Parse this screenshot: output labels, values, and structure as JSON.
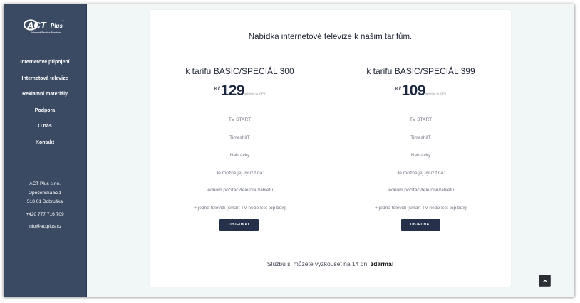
{
  "sidebar": {
    "logo_text": "ACT Plus s.r.o.",
    "logo_tagline": "Internet Service Provider",
    "nav": [
      {
        "label": "Internetové připojení"
      },
      {
        "label": "Internetová televize"
      },
      {
        "label": "Reklamní materiály"
      },
      {
        "label": "Podpora"
      },
      {
        "label": "O nás"
      },
      {
        "label": "Kontakt"
      }
    ],
    "contact": {
      "company": "ACT Plus s.r.o.",
      "street": "Opočenská 531",
      "city": "518 01 Dobruška",
      "phone": "+420 777 716 709",
      "email": "info@actplus.cz"
    }
  },
  "main": {
    "title": "Nabídka internetové televize k našim tarifům.",
    "tariffs": [
      {
        "name": "k tarifu BASIC/SPECIÁL 300",
        "currency": "Kč",
        "price": "129",
        "price_note": "měsíčně vč. DPH",
        "features": [
          "TV START",
          "TimeshifT",
          "Nahrávky",
          "Je možné jej využít na:",
          "jednom počítači/telefonu/tabletu",
          "+ jedné televizi (smart TV nebo Set-top box)"
        ],
        "button": "OBJEDNAT"
      },
      {
        "name": "k tarifu BASIC/SPECIÁL 399",
        "currency": "Kč",
        "price": "109",
        "price_note": "měsíčně vč. DPH",
        "features": [
          "TV START",
          "TimeshifT",
          "Nahrávky",
          "Je možné jej využít na:",
          "jednom počítači/telefonu/tabletu",
          "+ jedné televizi (smart TV nebo Set-top box)"
        ],
        "button": "OBJEDNAT"
      }
    ],
    "trial": {
      "before": "Službu si můžete vyzkoušet na 14 dní ",
      "bold": "zdarma",
      "after": "!"
    }
  },
  "scroll_top": {
    "icon": "chevron-up-icon"
  },
  "colors": {
    "sidebar_bg": "#3a4a63",
    "button_bg": "#25304a",
    "page_bg": "#f1f7f6"
  }
}
